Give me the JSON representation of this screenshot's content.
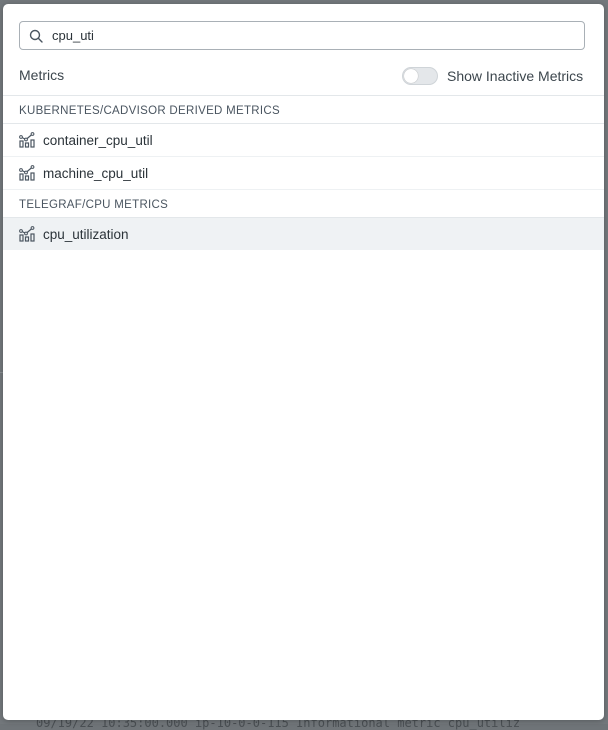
{
  "search": {
    "value": "cpu_uti",
    "icon": "search-icon"
  },
  "header": {
    "metrics_label": "Metrics",
    "toggle_label": "Show Inactive Metrics",
    "toggle_on": false
  },
  "groups": [
    {
      "title": "KUBERNETES/CADVISOR DERIVED METRICS",
      "items": [
        {
          "name": "container_cpu_util",
          "icon": "metric-graph-icon"
        },
        {
          "name": "machine_cpu_util",
          "icon": "metric-graph-icon"
        }
      ]
    },
    {
      "title": "TELEGRAF/CPU METRICS",
      "items": [
        {
          "name": "cpu_utilization",
          "icon": "metric-graph-icon",
          "selected": true
        }
      ]
    }
  ],
  "background": {
    "log_line": "09/19/22 10:35:00.000   ip-10-0-0-115     Informational     metric cpu_utiliz"
  },
  "colors": {
    "selected_row": "#eff2f4",
    "text": "#2b3339",
    "border": "#a9b0b6"
  }
}
